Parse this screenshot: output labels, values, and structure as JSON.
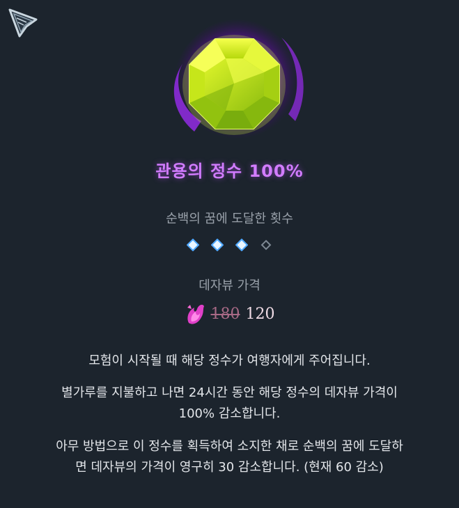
{
  "item": {
    "name": "관용의 정수 100%",
    "icon": "yellow-octagon-gem-icon"
  },
  "reach": {
    "label": "순백의 꿈에 도달한 횟수",
    "filled": 3,
    "total": 4
  },
  "price": {
    "label": "데자뷰 가격",
    "currency_icon": "pink-crystal-icon",
    "old": "180",
    "new": "120"
  },
  "description": {
    "line1": "모험이 시작될 때 해당 정수가 여행자에게 주어집니다.",
    "line2a": "별가루를 지불하고 나면 24시간 동안 해당 정수의 데자뷰 가격이",
    "line2b": "100% 감소합니다.",
    "line3a": "아무 방법으로 이 정수를 획득하여 소지한 채로 순백의 꿈에 도달하",
    "line3b": "면 데자뷰의 가격이 영구히 30 감소합니다. (현재 60 감소)"
  },
  "colors": {
    "background": "#1c242d",
    "title": "#d27cff",
    "gem": "#c8e60a",
    "aura": "#8a1fd6"
  }
}
